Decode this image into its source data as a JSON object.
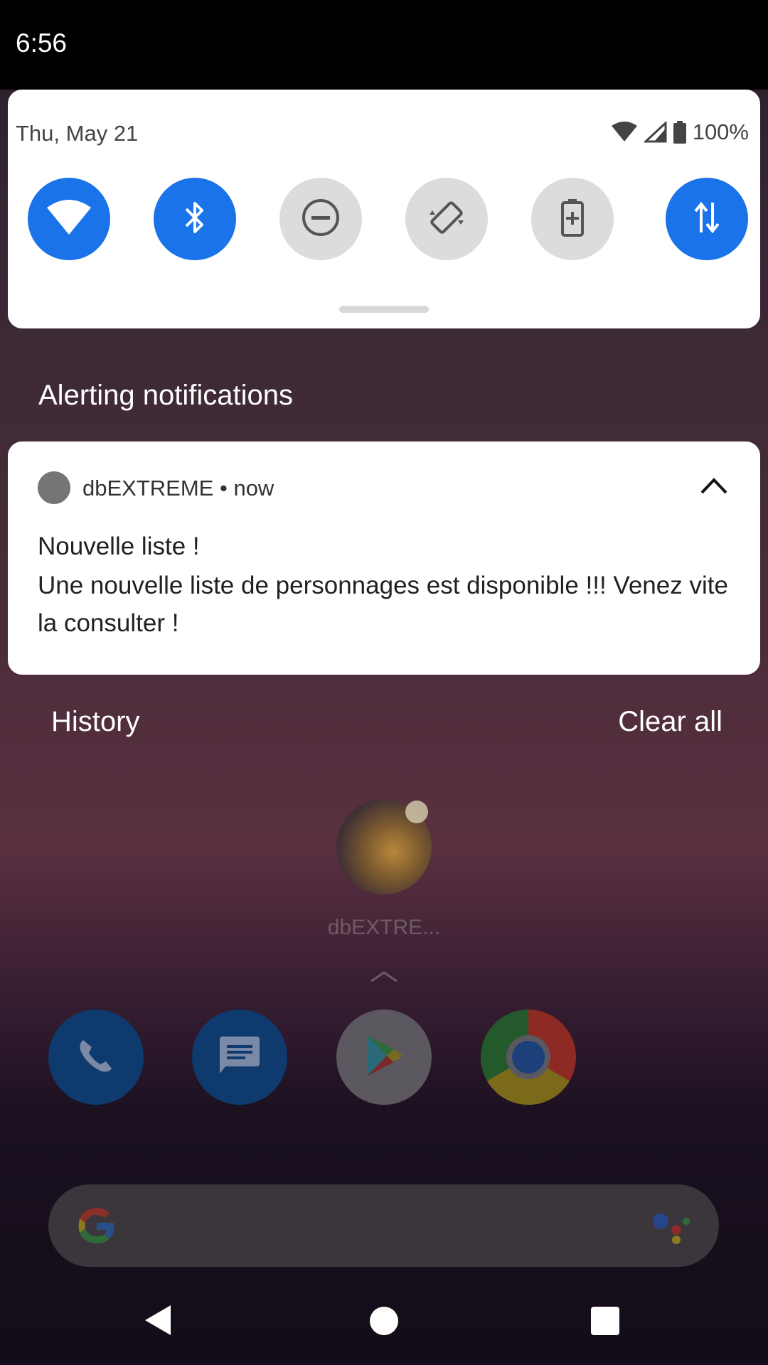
{
  "status_bar": {
    "time": "6:56"
  },
  "quick_settings": {
    "date": "Thu, May 21",
    "battery_percent": "100%",
    "tiles": [
      {
        "name": "wifi",
        "icon": "wifi-icon",
        "state": "on"
      },
      {
        "name": "bluetooth",
        "icon": "bluetooth-icon",
        "state": "on"
      },
      {
        "name": "do-not-disturb",
        "icon": "dnd-icon",
        "state": "off"
      },
      {
        "name": "auto-rotate",
        "icon": "rotate-icon",
        "state": "off"
      },
      {
        "name": "battery-saver",
        "icon": "battery-saver-icon",
        "state": "off"
      },
      {
        "name": "mobile-data",
        "icon": "data-arrows-icon",
        "state": "on"
      }
    ],
    "colors": {
      "tile_on": "#1a73e8",
      "tile_off": "#dcdcdc"
    }
  },
  "notifications": {
    "section_title": "Alerting notifications",
    "items": [
      {
        "app_name": "dbEXTREME",
        "separator": "•",
        "time": "now",
        "title": "Nouvelle liste !",
        "text": "Une nouvelle liste de personnages est disponible !!! Venez vite la consulter !"
      }
    ],
    "history_label": "History",
    "clear_all_label": "Clear all"
  },
  "home": {
    "app_label": "dbEXTRE...",
    "dock": [
      "phone-icon",
      "messages-icon",
      "play-store-icon",
      "chrome-icon"
    ]
  }
}
